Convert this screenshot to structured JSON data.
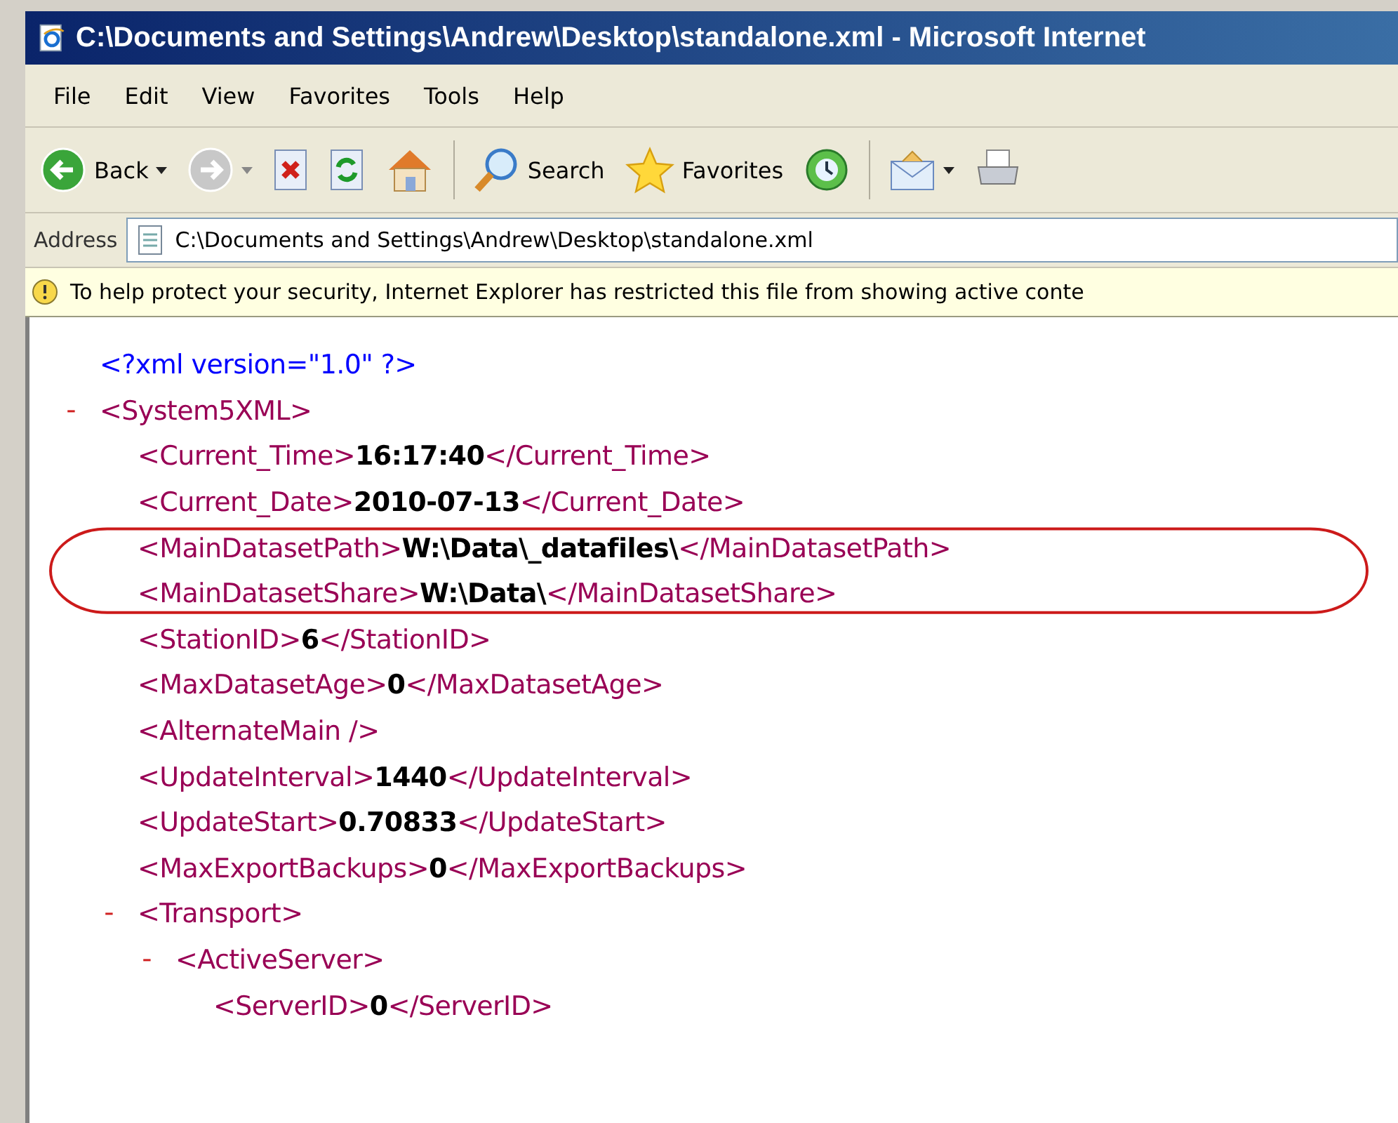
{
  "window": {
    "title": "C:\\Documents and Settings\\Andrew\\Desktop\\standalone.xml - Microsoft Internet"
  },
  "menu": [
    "File",
    "Edit",
    "View",
    "Favorites",
    "Tools",
    "Help"
  ],
  "toolbar": [
    {
      "kind": "back",
      "label": "Back"
    },
    {
      "kind": "forward"
    },
    {
      "kind": "stop"
    },
    {
      "kind": "refresh"
    },
    {
      "kind": "home"
    },
    {
      "kind": "separator"
    },
    {
      "kind": "search",
      "label": "Search"
    },
    {
      "kind": "favorites",
      "label": "Favorites"
    },
    {
      "kind": "media"
    },
    {
      "kind": "separator"
    },
    {
      "kind": "mail"
    },
    {
      "kind": "print"
    }
  ],
  "address": {
    "label": "Address",
    "value": "C:\\Documents and Settings\\Andrew\\Desktop\\standalone.xml"
  },
  "info_bar": {
    "text": "To help protect your security, Internet Explorer has restricted this file from showing active conte"
  },
  "xml": [
    {
      "kind": "pi",
      "text": "<?xml version=\"1.0\" ?>"
    },
    {
      "kind": "element",
      "toggle": "-",
      "open": "<System5XML>",
      "children": [
        {
          "kind": "leaf",
          "open": "<Current_Time>",
          "value": "16:17:40",
          "close": "</Current_Time>",
          "circled": false
        },
        {
          "kind": "leaf",
          "open": "<Current_Date>",
          "value": "2010-07-13",
          "close": "</Current_Date>",
          "circled": false
        },
        {
          "kind": "leaf",
          "open": "<MainDatasetPath>",
          "value": "W:\\Data\\_datafiles\\",
          "close": "</MainDatasetPath>",
          "circled": true
        },
        {
          "kind": "leaf",
          "open": "<MainDatasetShare>",
          "value": "W:\\Data\\",
          "close": "</MainDatasetShare>",
          "circled": true
        },
        {
          "kind": "leaf",
          "open": "<StationID>",
          "value": "6",
          "close": "</StationID>",
          "circled": false
        },
        {
          "kind": "leaf",
          "open": "<MaxDatasetAge>",
          "value": "0",
          "close": "</MaxDatasetAge>",
          "circled": false
        },
        {
          "kind": "empty",
          "text": "<AlternateMain />"
        },
        {
          "kind": "leaf",
          "open": "<UpdateInterval>",
          "value": "1440",
          "close": "</UpdateInterval>",
          "circled": false
        },
        {
          "kind": "leaf",
          "open": "<UpdateStart>",
          "value": "0.70833",
          "close": "</UpdateStart>",
          "circled": false
        },
        {
          "kind": "leaf",
          "open": "<MaxExportBackups>",
          "value": "0",
          "close": "</MaxExportBackups>",
          "circled": false
        },
        {
          "kind": "element",
          "toggle": "-",
          "open": "<Transport>",
          "children": [
            {
              "kind": "element",
              "toggle": "-",
              "open": "<ActiveServer>",
              "children": [
                {
                  "kind": "leaf",
                  "open": "<ServerID>",
                  "value": "0",
                  "close": "</ServerID>",
                  "circled": false
                }
              ]
            }
          ]
        }
      ]
    }
  ]
}
